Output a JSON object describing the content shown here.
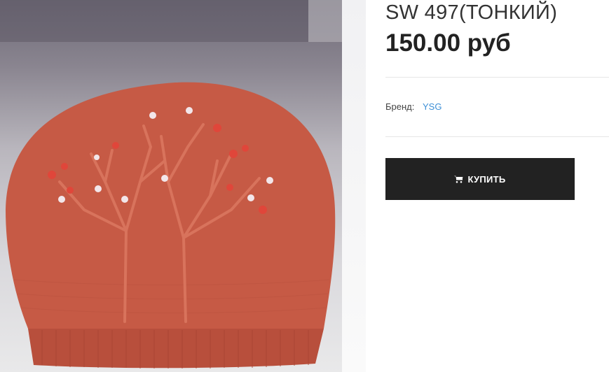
{
  "product": {
    "title": "SW 497(ТОНКИЙ)",
    "price": "150.00 руб",
    "brand_label": "Бренд:",
    "brand_value": "YSG",
    "buy_label": "КУПИТЬ",
    "image_icon": "product-photo-knitted-beret"
  },
  "colors": {
    "button_bg": "#222222",
    "link": "#3d8fd6",
    "hat": "#c65a45"
  }
}
